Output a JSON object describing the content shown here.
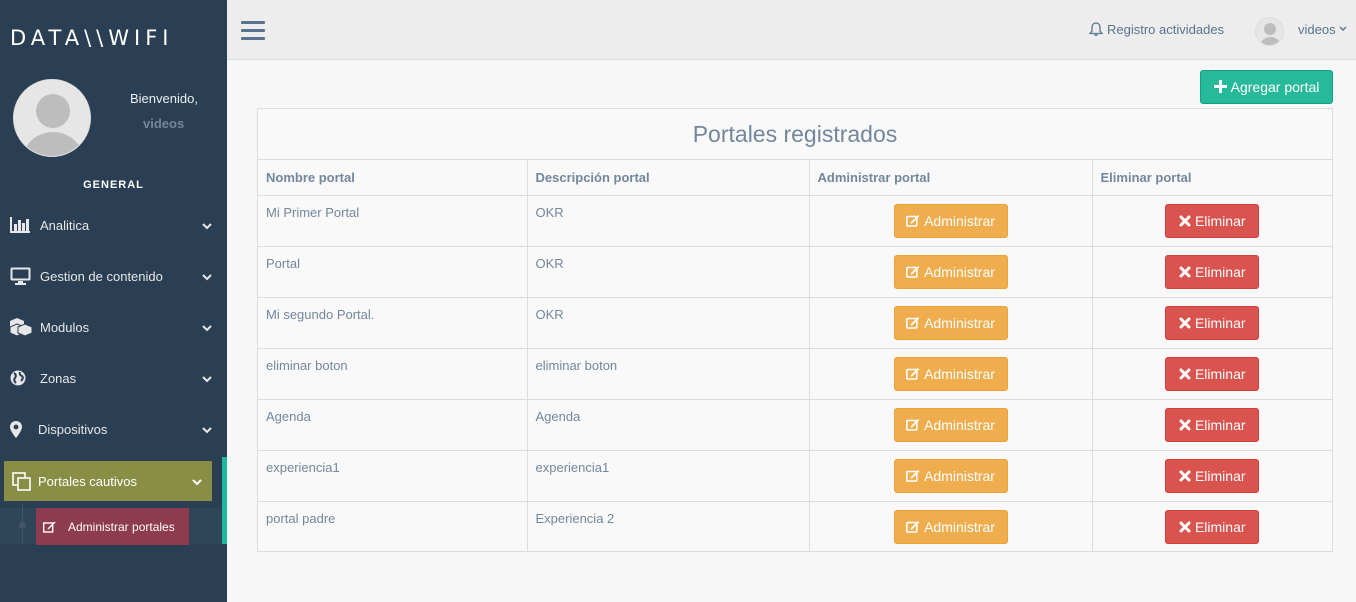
{
  "brand": {
    "logo_text": "DATA\\\\WIFI"
  },
  "sidebar": {
    "welcome": "Bienvenido,",
    "username": "videos",
    "section_title": "GENERAL",
    "items": [
      {
        "label": "Analitica",
        "icon": "bar-chart-icon"
      },
      {
        "label": "Gestion de contenido",
        "icon": "desktop-icon"
      },
      {
        "label": "Modulos",
        "icon": "cubes-icon"
      },
      {
        "label": "Zonas",
        "icon": "globe-icon"
      },
      {
        "label": "Dispositivos",
        "icon": "map-marker-icon"
      },
      {
        "label": "Portales cautivos",
        "icon": "clone-icon"
      }
    ],
    "submenu": {
      "label": "Administrar portales",
      "icon": "edit-icon"
    }
  },
  "topnav": {
    "activity_label": "Registro actividades",
    "user_label": "videos"
  },
  "main": {
    "add_button": "Agregar portal",
    "panel_title": "Portales registrados",
    "columns": [
      "Nombre portal",
      "Descripción portal",
      "Administrar portal",
      "Eliminar portal"
    ],
    "admin_label": "Administrar",
    "delete_label": "Eliminar",
    "rows": [
      {
        "name": "Mi Primer Portal",
        "desc": "OKR"
      },
      {
        "name": "Portal",
        "desc": "OKR"
      },
      {
        "name": "Mi segundo Portal.",
        "desc": "OKR"
      },
      {
        "name": "eliminar boton",
        "desc": "eliminar boton"
      },
      {
        "name": "Agenda",
        "desc": "Agenda"
      },
      {
        "name": "experiencia1",
        "desc": "experiencia1"
      },
      {
        "name": "portal padre",
        "desc": "Experiencia 2"
      }
    ]
  },
  "colors": {
    "sidebar_bg": "#2a3f54",
    "active_item": "#888f45",
    "submenu_active": "#8e3a4f",
    "accent": "#1abb9c",
    "success": "#26b99a",
    "warning": "#f0ad4e",
    "danger": "#d9534f"
  }
}
